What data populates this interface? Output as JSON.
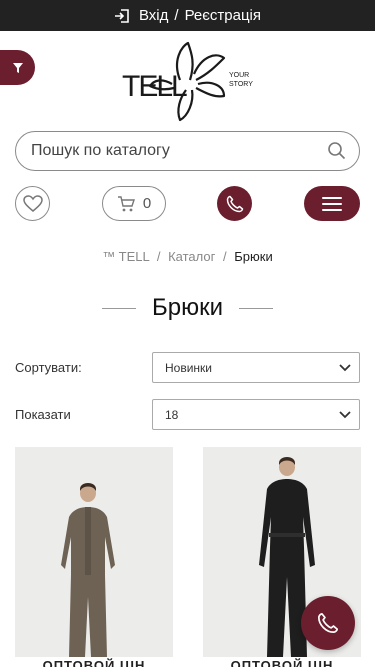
{
  "topbar": {
    "login": "Вхід",
    "separator": "/",
    "register": "Реєстрація",
    "icon": "login-icon"
  },
  "logo": {
    "brand": "TELL",
    "tagline_1": "YOUR",
    "tagline_2": "STORY"
  },
  "search": {
    "placeholder": "Пошук по каталогу",
    "value": ""
  },
  "header": {
    "cart_count": "0"
  },
  "breadcrumb": {
    "home": "™ TELL",
    "catalog": "Каталог",
    "current": "Брюки",
    "separator": "/"
  },
  "page": {
    "title": "Брюки"
  },
  "sort": {
    "label": "Сортувати:",
    "selected": "Новинки"
  },
  "show": {
    "label": "Показати",
    "selected": "18"
  },
  "products": [
    {
      "name": "ОПТОВОЙ ЦІН",
      "outfit_color": "#6e6254"
    },
    {
      "name": "ОПТОВОЙ ЦІН",
      "outfit_color": "#1e1e1e"
    }
  ],
  "colors": {
    "accent": "#6b1f2e",
    "topbar": "#222222"
  }
}
